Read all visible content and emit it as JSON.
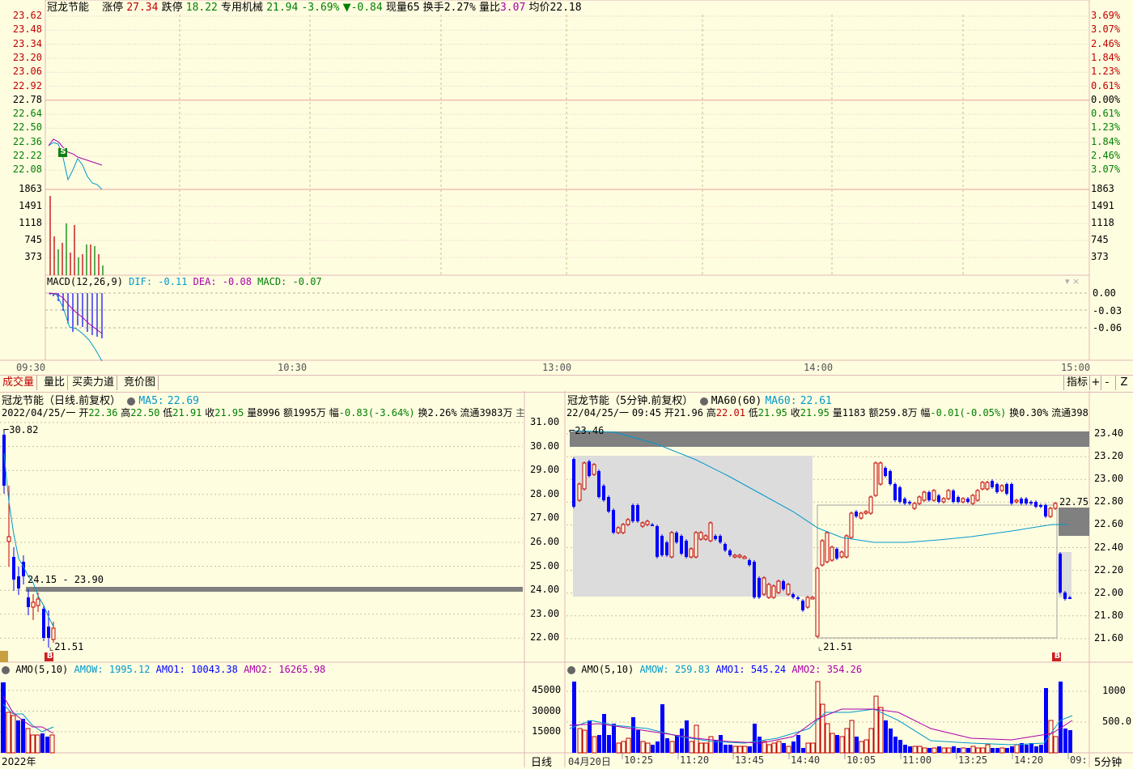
{
  "top_header": {
    "name": "冠龙节能",
    "zhangting_label": "涨停",
    "zhangting": "27.34",
    "dieting_label": "跌停",
    "dieting": "18.22",
    "industry": "专用机械",
    "price": "21.94",
    "pct": "-3.69%",
    "arrow": "▼",
    "change": "-0.84",
    "xianliang_label": "现量",
    "xianliang": "65",
    "huanshou_label": "换手",
    "huanshou": "2.27%",
    "liangbi_label": "量比",
    "liangbi": "3.07",
    "junjia_label": "均价",
    "junjia": "22.18"
  },
  "intraday": {
    "price_ticks_left": [
      "23.62",
      "23.48",
      "23.34",
      "23.20",
      "23.06",
      "22.92",
      "22.78",
      "22.64",
      "22.50",
      "22.36",
      "22.22",
      "22.08"
    ],
    "pct_ticks_right": [
      "3.69%",
      "3.07%",
      "2.46%",
      "1.84%",
      "1.23%",
      "0.61%",
      "0.00%",
      "0.61%",
      "1.23%",
      "1.84%",
      "2.46%",
      "3.07%"
    ],
    "vol_ticks": [
      "1863",
      "1491",
      "1118",
      "745",
      "373"
    ],
    "macd_label": "MACD(12,26,9)",
    "dif_label": "DIF:",
    "dif": "-0.11",
    "dea_label": "DEA:",
    "dea": "-0.08",
    "macd_val_label": "MACD:",
    "macd_val": "-0.07",
    "macd_ticks": [
      "0.00",
      "-0.03",
      "-0.06"
    ],
    "time_ticks": [
      "09:30",
      "10:30",
      "13:00",
      "14:00",
      "15:00"
    ],
    "s_marker": "S",
    "close_icon_chars": "▾ ×"
  },
  "tabs": [
    "成交量",
    "量比",
    "买卖力道",
    "竞价图"
  ],
  "right_tools": {
    "indicator": "指标",
    "plus": "+",
    "minus": "-",
    "z": "Z"
  },
  "daily": {
    "title": "冠龙节能（日线.前复权）",
    "ma_label": "MA5:",
    "ma_value": "22.69",
    "info": {
      "date": "2022/04/25/一",
      "open_label": "开",
      "open": "22.36",
      "high_label": "高",
      "high": "22.50",
      "low_label": "低",
      "low": "21.91",
      "close_label": "收",
      "close": "21.95",
      "vol_label": "量",
      "vol": "8996",
      "amt_label": "额",
      "amt": "1995万",
      "fu_label": "幅",
      "fu": "-0.83(-3.64%)",
      "hs_label": "换",
      "hs": "2.26%",
      "lt_label": "流通",
      "lt": "3983万",
      "trunc": "主"
    },
    "price_ticks": [
      "31.00",
      "30.00",
      "29.00",
      "28.00",
      "27.00",
      "26.00",
      "25.00",
      "24.00",
      "23.00",
      "22.00"
    ],
    "high_mark": "30.82",
    "low_mark": "21.51",
    "gap_label": "24.15 - 23.90",
    "b_marker": "B",
    "amo": {
      "label": "AMO(5,10)",
      "w_label": "AMOW:",
      "w": "1995.12",
      "a1_label": "AMO1:",
      "a1": "10043.38",
      "a2_label": "AMO2:",
      "a2": "16265.98",
      "ticks": [
        "45000",
        "30000",
        "15000"
      ]
    },
    "bottom_year": "2022年",
    "bottom_right": "日线"
  },
  "five_min": {
    "title": "冠龙节能（5分钟.前复权）",
    "ma_label": "MA60(60)",
    "ma_label2": "MA60:",
    "ma_value": "22.61",
    "info": {
      "date": "22/04/25/一",
      "time": "09:45",
      "open_label": "开",
      "open": "21.96",
      "high_label": "高",
      "high": "22.01",
      "low_label": "低",
      "low": "21.95",
      "close_label": "收",
      "close": "21.95",
      "vol_label": "量",
      "vol": "1183",
      "amt_label": "额",
      "amt": "259.8万",
      "fu_label": "幅",
      "fu": "-0.01(-0.05%)",
      "hs_label": "换",
      "hs": "0.30%",
      "lt_label": "流通",
      "lt": "398"
    },
    "price_ticks": [
      "23.40",
      "23.20",
      "23.00",
      "22.80",
      "22.60",
      "22.40",
      "22.20",
      "22.00",
      "21.80",
      "21.60"
    ],
    "high_mark": "23.46",
    "low_mark": "21.51",
    "right_mark": "22.75",
    "b_marker": "B",
    "amo": {
      "label": "AMO(5,10)",
      "w_label": "AMOW:",
      "w": "259.83",
      "a1_label": "AMO1:",
      "a1": "545.24",
      "a2_label": "AMO2:",
      "a2": "354.26",
      "ticks": [
        "1000",
        "500.0"
      ]
    },
    "time_ticks": [
      "04月20日",
      "10:25",
      "11:20",
      "13:45",
      "14:40",
      "10:05",
      "11:00",
      "13:25",
      "14:20",
      "09:"
    ],
    "bottom_right": "5分钟"
  },
  "colors": {
    "up": "#c00000",
    "down": "#0000ff",
    "bg": "#fffde0",
    "grid": "#e8c0c0",
    "ma": "#0099cc"
  }
}
